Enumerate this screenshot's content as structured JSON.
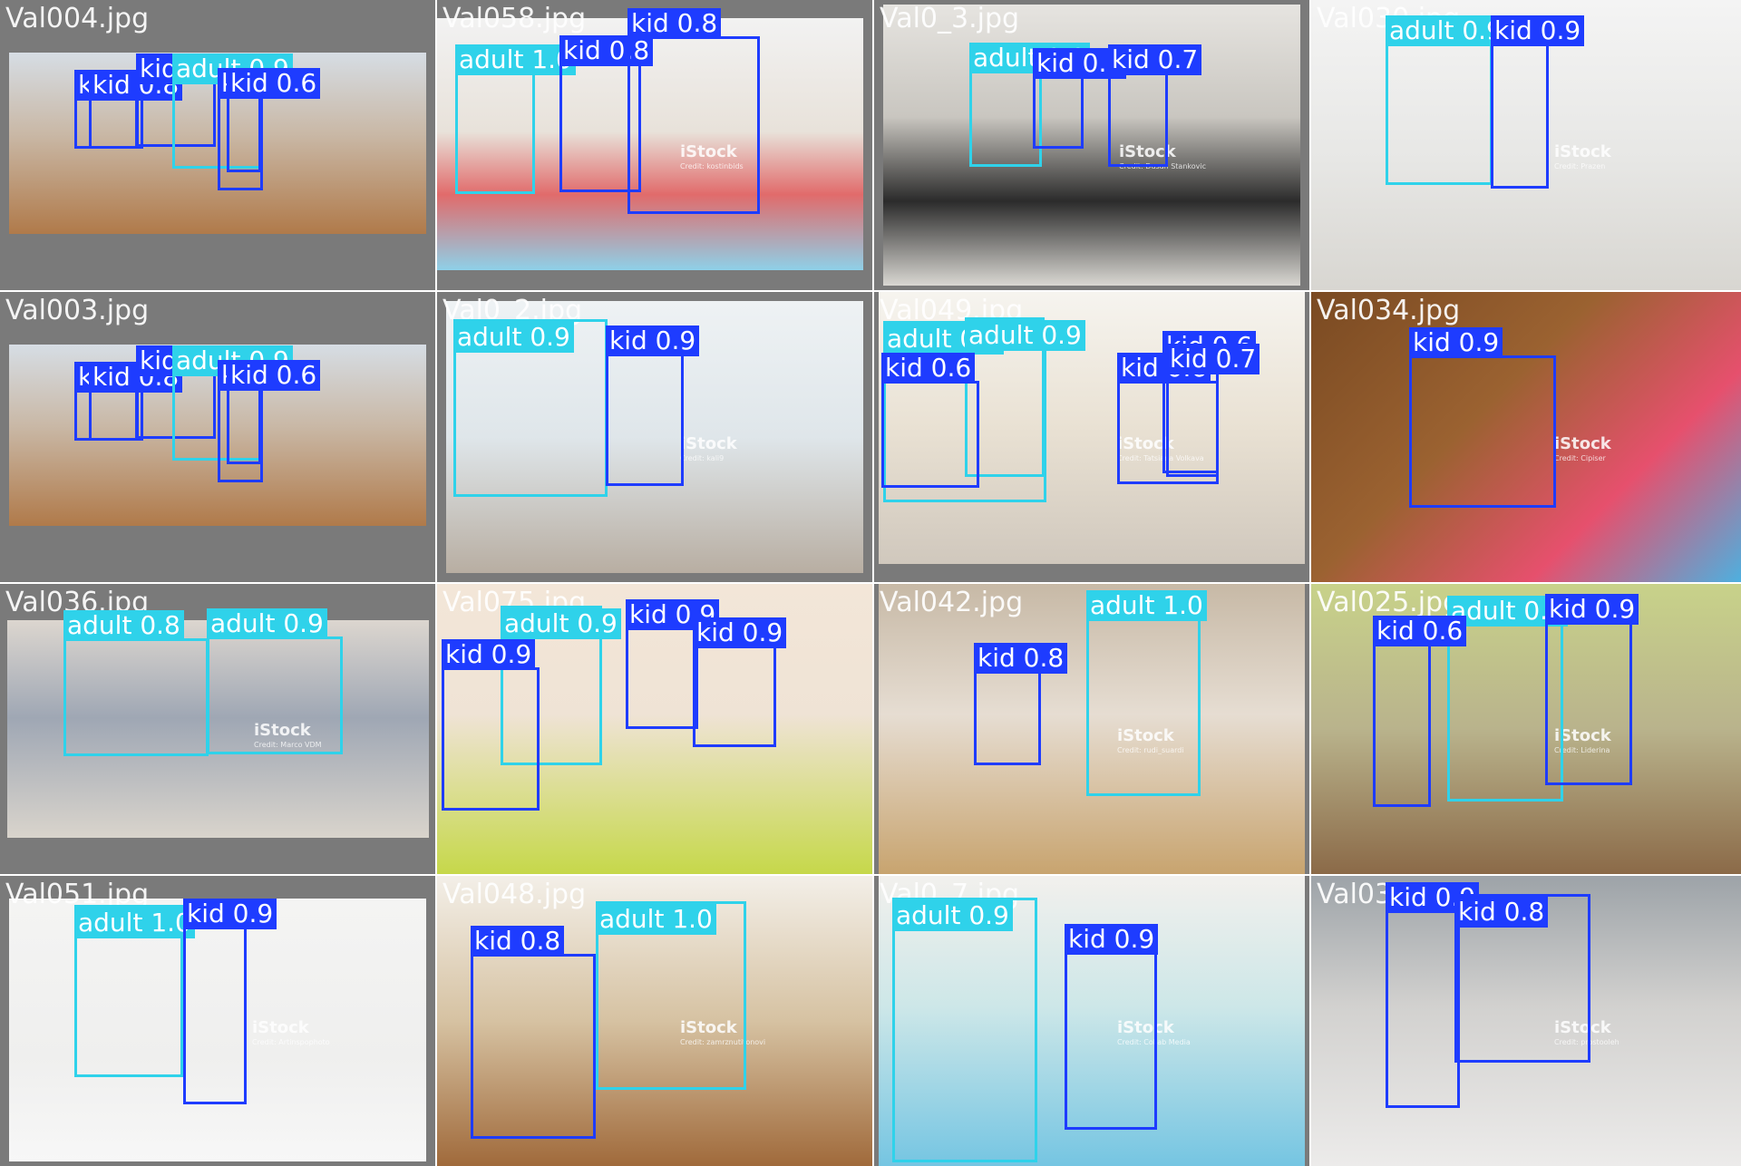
{
  "colors": {
    "kid_box": "#1e3cff",
    "adult_box": "#2fd2ea",
    "label_text": "#ffffff",
    "letterbox": "#7a7a7a",
    "grid_line": "#ffffff"
  },
  "tiles": [
    {
      "filename": "Val004.jpg",
      "watermark": "",
      "credit": "",
      "boxes": [
        {
          "label": "kid 0.5",
          "cls": "kid"
        },
        {
          "label": "kid 0.8",
          "cls": "kid"
        },
        {
          "label": "kid 0.6",
          "cls": "kid"
        },
        {
          "label": "adult 0.9",
          "cls": "adult"
        },
        {
          "label": "kid 0.6",
          "cls": "kid"
        },
        {
          "label": "kid 0.6",
          "cls": "kid"
        }
      ]
    },
    {
      "filename": "Val058.jpg",
      "watermark": "iStock",
      "credit": "Credit: kostinbids",
      "boxes": [
        {
          "label": "adult 1.0",
          "cls": "adult"
        },
        {
          "label": "kid 0.8",
          "cls": "kid"
        },
        {
          "label": "kid 0.8",
          "cls": "kid"
        }
      ]
    },
    {
      "filename": "Val0_3.jpg",
      "watermark": "iStock",
      "credit": "Credit: Dusan Stankovic",
      "boxes": [
        {
          "label": "adult 0.8",
          "cls": "adult"
        },
        {
          "label": "kid 0.9",
          "cls": "kid"
        },
        {
          "label": "kid 0.7",
          "cls": "kid"
        }
      ]
    },
    {
      "filename": "Val030.jpg",
      "watermark": "iStock",
      "credit": "Credit: Prazen",
      "boxes": [
        {
          "label": "adult 0.9",
          "cls": "adult"
        },
        {
          "label": "kid 0.9",
          "cls": "kid"
        }
      ]
    },
    {
      "filename": "Val003.jpg",
      "watermark": "",
      "credit": "",
      "boxes": [
        {
          "label": "kid 0.5",
          "cls": "kid"
        },
        {
          "label": "kid 0.8",
          "cls": "kid"
        },
        {
          "label": "kid 0.6",
          "cls": "kid"
        },
        {
          "label": "adult 0.9",
          "cls": "adult"
        },
        {
          "label": "kid 0.6",
          "cls": "kid"
        },
        {
          "label": "kid 0.6",
          "cls": "kid"
        }
      ]
    },
    {
      "filename": "Val0_2.jpg",
      "watermark": "iStock",
      "credit": "Credit: kali9",
      "boxes": [
        {
          "label": "adult 0.9",
          "cls": "adult"
        },
        {
          "label": "kid 0.9",
          "cls": "kid"
        }
      ]
    },
    {
      "filename": "Val049.jpg",
      "watermark": "iStock",
      "credit": "Credit: Tatsiana Volkava",
      "boxes": [
        {
          "label": "adult 0.7",
          "cls": "adult"
        },
        {
          "label": "adult 0.9",
          "cls": "adult"
        },
        {
          "label": "kid 0.6",
          "cls": "kid"
        },
        {
          "label": "kid 0.6",
          "cls": "kid"
        },
        {
          "label": "kid 0.6",
          "cls": "kid"
        },
        {
          "label": "kid 0.7",
          "cls": "kid"
        }
      ]
    },
    {
      "filename": "Val034.jpg",
      "watermark": "iStock",
      "credit": "Credit: Cipiser",
      "boxes": [
        {
          "label": "kid 0.9",
          "cls": "kid"
        }
      ]
    },
    {
      "filename": "Val036.jpg",
      "watermark": "iStock",
      "credit": "Credit: Marco VDM",
      "boxes": [
        {
          "label": "adult 0.8",
          "cls": "adult"
        },
        {
          "label": "adult 0.9",
          "cls": "adult"
        }
      ]
    },
    {
      "filename": "Val075.jpg",
      "watermark": "",
      "credit": "",
      "boxes": [
        {
          "label": "adult 0.9",
          "cls": "adult"
        },
        {
          "label": "kid 0.9",
          "cls": "kid"
        },
        {
          "label": "kid 0.9",
          "cls": "kid"
        },
        {
          "label": "kid 0.9",
          "cls": "kid"
        }
      ]
    },
    {
      "filename": "Val042.jpg",
      "watermark": "iStock",
      "credit": "Credit: rudi_suardi",
      "boxes": [
        {
          "label": "adult 1.0",
          "cls": "adult"
        },
        {
          "label": "kid 0.8",
          "cls": "kid"
        }
      ]
    },
    {
      "filename": "Val025.jpg",
      "watermark": "iStock",
      "credit": "Credit: Liderina",
      "boxes": [
        {
          "label": "adult 0.7",
          "cls": "adult"
        },
        {
          "label": "kid 0.6",
          "cls": "kid"
        },
        {
          "label": "kid 0.9",
          "cls": "kid"
        }
      ]
    },
    {
      "filename": "Val051.jpg",
      "watermark": "iStock",
      "credit": "Credit: Artinspophoto",
      "boxes": [
        {
          "label": "adult 1.0",
          "cls": "adult"
        },
        {
          "label": "kid 0.9",
          "cls": "kid"
        }
      ]
    },
    {
      "filename": "Val048.jpg",
      "watermark": "iStock",
      "credit": "Credit: zamrznutitonovi",
      "boxes": [
        {
          "label": "adult 1.0",
          "cls": "adult"
        },
        {
          "label": "kid 0.8",
          "cls": "kid"
        }
      ]
    },
    {
      "filename": "Val0_7.jpg",
      "watermark": "iStock",
      "credit": "Credit: Collab Media",
      "boxes": [
        {
          "label": "adult 0.9",
          "cls": "adult"
        },
        {
          "label": "kid 0.9",
          "cls": "kid"
        }
      ]
    },
    {
      "filename": "Val037.jpg",
      "watermark": "iStock",
      "credit": "Credit: prostooleh",
      "boxes": [
        {
          "label": "kid 0.9",
          "cls": "kid"
        },
        {
          "label": "kid 0.8",
          "cls": "kid"
        }
      ]
    }
  ]
}
